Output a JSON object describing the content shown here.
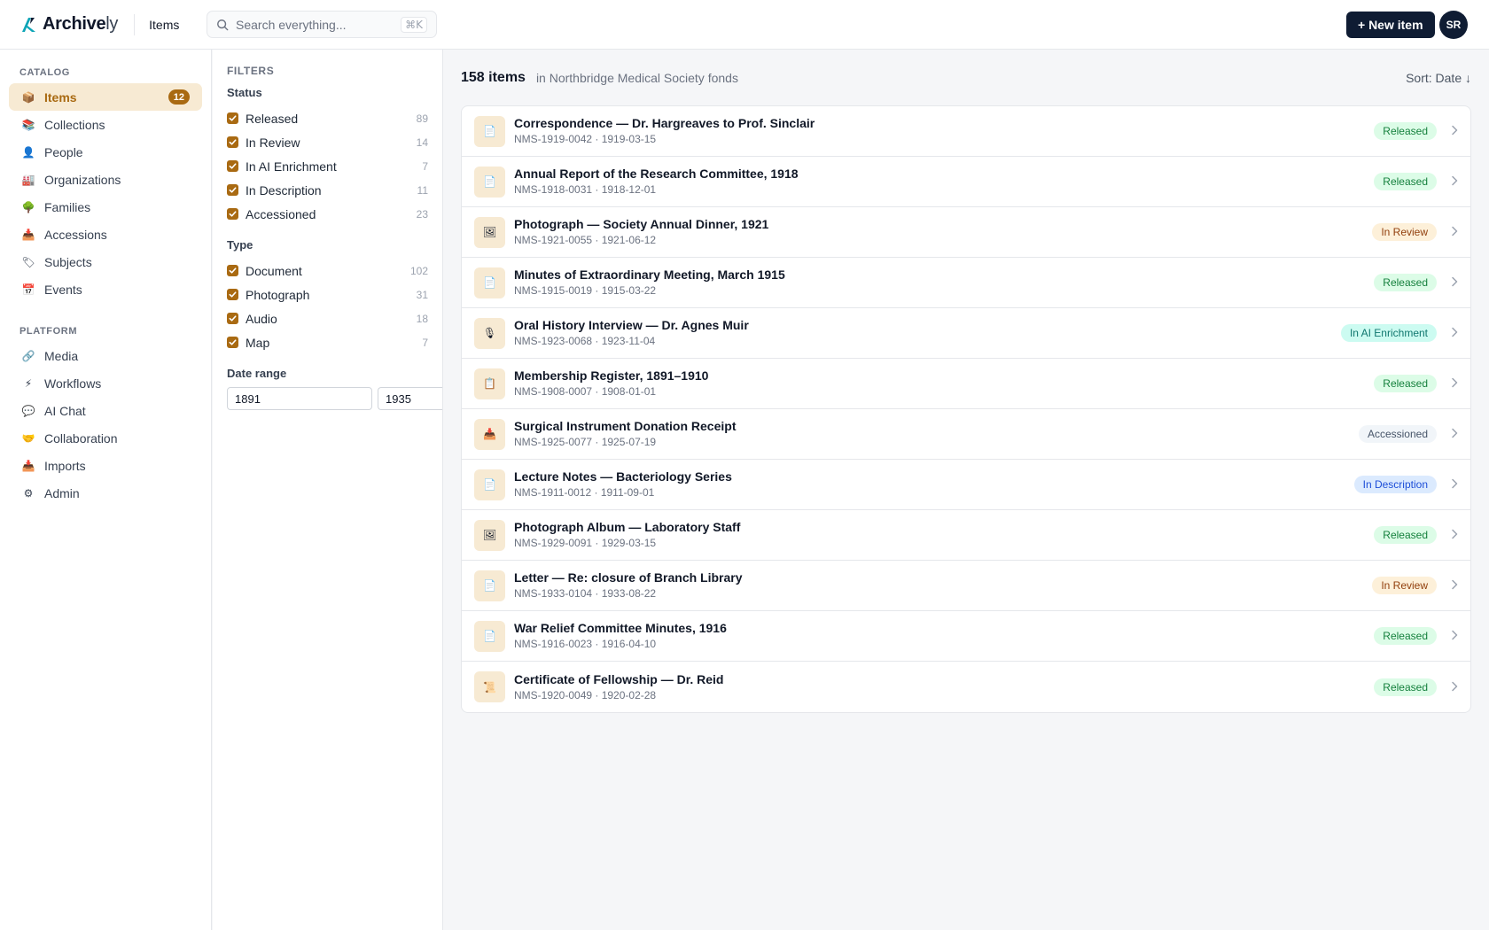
{
  "app": {
    "logo_main": "Archive",
    "logo_light": "ly",
    "breadcrumb": "Items"
  },
  "search": {
    "placeholder": "Search everything...",
    "shortcut": "⌘K"
  },
  "header_actions": {
    "new_item_label": "+ New item",
    "avatar_initials": "SR"
  },
  "colors": {
    "accent": "#a96a12",
    "accent_bg": "#f7ead3",
    "navy": "#0f1c33"
  },
  "sidebar": {
    "catalog_label": "CATALOG",
    "catalog": [
      {
        "label": "Items",
        "icon": "📦",
        "badge": "12",
        "active": true
      },
      {
        "label": "Collections",
        "icon": "📚"
      },
      {
        "label": "People",
        "icon": "👤"
      },
      {
        "label": "Organizations",
        "icon": "🏭"
      },
      {
        "label": "Families",
        "icon": "🌳"
      },
      {
        "label": "Accessions",
        "icon": "📥"
      },
      {
        "label": "Subjects",
        "icon": "🏷"
      },
      {
        "label": "Events",
        "icon": "📅"
      }
    ],
    "platform_label": "PLATFORM",
    "platform": [
      {
        "label": "Media",
        "icon": "🔗"
      },
      {
        "label": "Workflows",
        "icon": "⚡"
      },
      {
        "label": "AI Chat",
        "icon": "💬"
      },
      {
        "label": "Collaboration",
        "icon": "🤝"
      },
      {
        "label": "Imports",
        "icon": "📥"
      },
      {
        "label": "Admin",
        "icon": "⚙"
      }
    ]
  },
  "filters": {
    "title": "FILTERS",
    "status_title": "Status",
    "status": [
      {
        "label": "Released",
        "count": "89"
      },
      {
        "label": "In Review",
        "count": "14"
      },
      {
        "label": "In AI Enrichment",
        "count": "7"
      },
      {
        "label": "In Description",
        "count": "11"
      },
      {
        "label": "Accessioned",
        "count": "23"
      }
    ],
    "type_title": "Type",
    "type": [
      {
        "label": "Document",
        "count": "102"
      },
      {
        "label": "Photograph",
        "count": "31"
      },
      {
        "label": "Audio",
        "count": "18"
      },
      {
        "label": "Map",
        "count": "7"
      }
    ],
    "date_title": "Date range",
    "date_from": "1891",
    "date_to": "1935"
  },
  "list": {
    "count_label": "158 items",
    "scope_label": "in Northbridge Medical Society fonds",
    "sort_label": "Sort: Date ↓",
    "items": [
      {
        "title": "Correspondence — Dr. Hargreaves to Prof. Sinclair",
        "meta": "NMS-1919-0042 · 1919-03-15",
        "status": "Released",
        "kind": "released",
        "icon": "📄"
      },
      {
        "title": "Annual Report of the Research Committee, 1918",
        "meta": "NMS-1918-0031 · 1918-12-01",
        "status": "Released",
        "kind": "released",
        "icon": "📄"
      },
      {
        "title": "Photograph — Society Annual Dinner, 1921",
        "meta": "NMS-1921-0055 · 1921-06-12",
        "status": "In Review",
        "kind": "review",
        "icon": "🖼"
      },
      {
        "title": "Minutes of Extraordinary Meeting, March 1915",
        "meta": "NMS-1915-0019 · 1915-03-22",
        "status": "Released",
        "kind": "released",
        "icon": "📄"
      },
      {
        "title": "Oral History Interview — Dr. Agnes Muir",
        "meta": "NMS-1923-0068 · 1923-11-04",
        "status": "In AI Enrichment",
        "kind": "ai",
        "icon": "🎙"
      },
      {
        "title": "Membership Register, 1891–1910",
        "meta": "NMS-1908-0007 · 1908-01-01",
        "status": "Released",
        "kind": "released",
        "icon": "📋"
      },
      {
        "title": "Surgical Instrument Donation Receipt",
        "meta": "NMS-1925-0077 · 1925-07-19",
        "status": "Accessioned",
        "kind": "accessioned",
        "icon": "📥"
      },
      {
        "title": "Lecture Notes — Bacteriology Series",
        "meta": "NMS-1911-0012 · 1911-09-01",
        "status": "In Description",
        "kind": "description",
        "icon": "📄"
      },
      {
        "title": "Photograph Album — Laboratory Staff",
        "meta": "NMS-1929-0091 · 1929-03-15",
        "status": "Released",
        "kind": "released",
        "icon": "🖼"
      },
      {
        "title": "Letter — Re: closure of Branch Library",
        "meta": "NMS-1933-0104 · 1933-08-22",
        "status": "In Review",
        "kind": "review",
        "icon": "📄"
      },
      {
        "title": "War Relief Committee Minutes, 1916",
        "meta": "NMS-1916-0023 · 1916-04-10",
        "status": "Released",
        "kind": "released",
        "icon": "📄"
      },
      {
        "title": "Certificate of Fellowship — Dr. Reid",
        "meta": "NMS-1920-0049 · 1920-02-28",
        "status": "Released",
        "kind": "released",
        "icon": "📜"
      }
    ]
  }
}
